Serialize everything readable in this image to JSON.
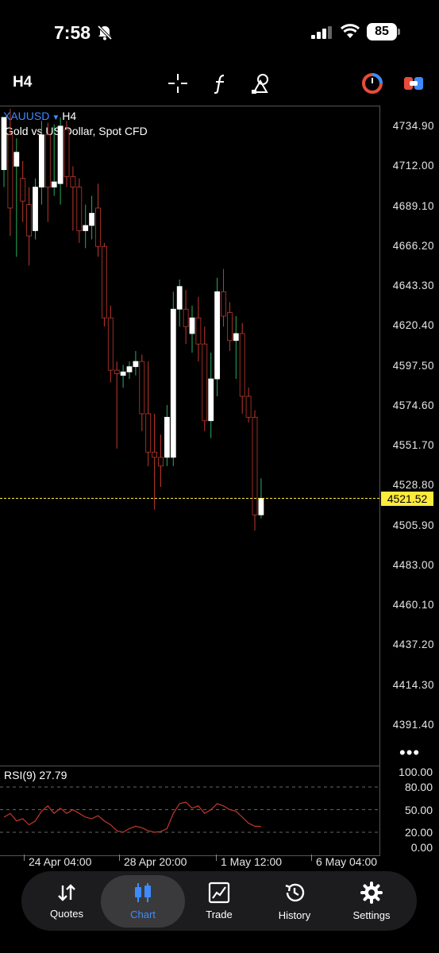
{
  "status_bar": {
    "time": "7:58",
    "battery": "85"
  },
  "header": {
    "timeframe": "H4"
  },
  "chart_header": {
    "symbol": "XAUUSD",
    "timeframe": "H4",
    "description": "Gold vs US Dollar, Spot CFD"
  },
  "price_axis": [
    "4734.90",
    "4712.00",
    "4689.10",
    "4666.20",
    "4643.30",
    "4620.40",
    "4597.50",
    "4574.60",
    "4551.70",
    "4528.80",
    "4505.90",
    "4483.00",
    "4460.10",
    "4437.20",
    "4414.30",
    "4391.40"
  ],
  "current_price": "4521.52",
  "rsi": {
    "label": "RSI(9) 27.79",
    "axis": [
      "100.00",
      "80.00",
      "50.00",
      "20.00",
      "0.00"
    ]
  },
  "time_axis": [
    "24 Apr 04:00",
    "28 Apr 20:00",
    "1 May 12:00",
    "6 May 04:00"
  ],
  "tabs": [
    {
      "label": "Quotes",
      "icon": "quotes-icon"
    },
    {
      "label": "Chart",
      "icon": "chart-candles-icon"
    },
    {
      "label": "Trade",
      "icon": "trade-icon"
    },
    {
      "label": "History",
      "icon": "history-icon"
    },
    {
      "label": "Settings",
      "icon": "settings-icon"
    }
  ],
  "active_tab": "Chart",
  "colors": {
    "bull": "#ffffff",
    "bear": "#000000",
    "bear_wick": "#c0392b",
    "bull_wick": "#27ae60",
    "accent": "#3d8bff",
    "price_line": "#ffeb3b",
    "rsi_line": "#c0392b"
  },
  "chart_data": {
    "type": "candlestick",
    "symbol": "XAUUSD",
    "timeframe": "H4",
    "y_range": [
      4391.4,
      4734.9
    ],
    "x_ticks": [
      "24 Apr 04:00",
      "28 Apr 20:00",
      "1 May 12:00",
      "6 May 04:00"
    ],
    "candles": [
      {
        "o": 4710,
        "h": 4740,
        "l": 4700,
        "c": 4740
      },
      {
        "o": 4730,
        "h": 4745,
        "l": 4672,
        "c": 4688
      },
      {
        "o": 4712,
        "h": 4728,
        "l": 4660,
        "c": 4720
      },
      {
        "o": 4705,
        "h": 4715,
        "l": 4680,
        "c": 4692
      },
      {
        "o": 4690,
        "h": 4700,
        "l": 4655,
        "c": 4672
      },
      {
        "o": 4675,
        "h": 4705,
        "l": 4670,
        "c": 4700
      },
      {
        "o": 4700,
        "h": 4738,
        "l": 4690,
        "c": 4730
      },
      {
        "o": 4730,
        "h": 4737,
        "l": 4680,
        "c": 4700
      },
      {
        "o": 4700,
        "h": 4736,
        "l": 4695,
        "c": 4703
      },
      {
        "o": 4702,
        "h": 4740,
        "l": 4690,
        "c": 4735
      },
      {
        "o": 4733,
        "h": 4738,
        "l": 4700,
        "c": 4706
      },
      {
        "o": 4706,
        "h": 4712,
        "l": 4675,
        "c": 4700
      },
      {
        "o": 4700,
        "h": 4705,
        "l": 4668,
        "c": 4675
      },
      {
        "o": 4675,
        "h": 4690,
        "l": 4665,
        "c": 4678
      },
      {
        "o": 4678,
        "h": 4695,
        "l": 4670,
        "c": 4685
      },
      {
        "o": 4688,
        "h": 4702,
        "l": 4660,
        "c": 4666
      },
      {
        "o": 4666,
        "h": 4668,
        "l": 4620,
        "c": 4625
      },
      {
        "o": 4625,
        "h": 4632,
        "l": 4588,
        "c": 4595
      },
      {
        "o": 4595,
        "h": 4600,
        "l": 4550,
        "c": 4593
      },
      {
        "o": 4592,
        "h": 4598,
        "l": 4585,
        "c": 4594
      },
      {
        "o": 4594,
        "h": 4600,
        "l": 4590,
        "c": 4597
      },
      {
        "o": 4597,
        "h": 4606,
        "l": 4592,
        "c": 4600
      },
      {
        "o": 4600,
        "h": 4604,
        "l": 4560,
        "c": 4570
      },
      {
        "o": 4570,
        "h": 4600,
        "l": 4540,
        "c": 4548
      },
      {
        "o": 4548,
        "h": 4570,
        "l": 4515,
        "c": 4545
      },
      {
        "o": 4545,
        "h": 4558,
        "l": 4528,
        "c": 4540
      },
      {
        "o": 4545,
        "h": 4575,
        "l": 4540,
        "c": 4568
      },
      {
        "o": 4545,
        "h": 4640,
        "l": 4540,
        "c": 4630
      },
      {
        "o": 4630,
        "h": 4647,
        "l": 4620,
        "c": 4643
      },
      {
        "o": 4630,
        "h": 4641,
        "l": 4610,
        "c": 4620
      },
      {
        "o": 4616,
        "h": 4632,
        "l": 4605,
        "c": 4625
      },
      {
        "o": 4625,
        "h": 4637,
        "l": 4600,
        "c": 4610
      },
      {
        "o": 4610,
        "h": 4620,
        "l": 4560,
        "c": 4566
      },
      {
        "o": 4566,
        "h": 4605,
        "l": 4556,
        "c": 4590
      },
      {
        "o": 4590,
        "h": 4648,
        "l": 4580,
        "c": 4640
      },
      {
        "o": 4640,
        "h": 4653,
        "l": 4620,
        "c": 4626
      },
      {
        "o": 4628,
        "h": 4634,
        "l": 4606,
        "c": 4612
      },
      {
        "o": 4612,
        "h": 4626,
        "l": 4590,
        "c": 4616
      },
      {
        "o": 4616,
        "h": 4622,
        "l": 4570,
        "c": 4580
      },
      {
        "o": 4580,
        "h": 4585,
        "l": 4565,
        "c": 4568
      },
      {
        "o": 4568,
        "h": 4572,
        "l": 4503,
        "c": 4512
      },
      {
        "o": 4512,
        "h": 4533,
        "l": 4510,
        "c": 4521.52
      }
    ],
    "rsi": {
      "name": "RSI(9)",
      "current": 27.79,
      "levels": [
        80,
        50,
        20
      ],
      "y_range": [
        0,
        100
      ],
      "values": [
        40,
        45,
        35,
        38,
        30,
        35,
        48,
        55,
        45,
        52,
        45,
        50,
        45,
        40,
        38,
        42,
        35,
        30,
        22,
        20,
        25,
        28,
        26,
        22,
        20,
        21,
        25,
        45,
        58,
        60,
        52,
        55,
        45,
        50,
        58,
        55,
        50,
        48,
        40,
        32,
        28,
        27.79
      ]
    }
  }
}
